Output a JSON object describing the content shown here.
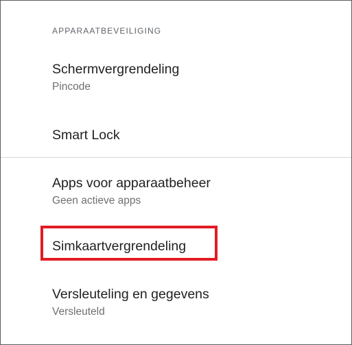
{
  "section": {
    "header": "APPARAATBEVEILIGING"
  },
  "items": [
    {
      "title": "Schermvergrendeling",
      "summary": "Pincode"
    },
    {
      "title": "Smart Lock"
    },
    {
      "title": "Apps voor apparaatbeheer",
      "summary": "Geen actieve apps"
    },
    {
      "title": "Simkaartvergrendeling"
    },
    {
      "title": "Versleuteling en gegevens",
      "summary": "Versleuteld"
    }
  ],
  "highlight": {
    "color": "#e21b23",
    "target": "Simkaartvergrendeling"
  }
}
